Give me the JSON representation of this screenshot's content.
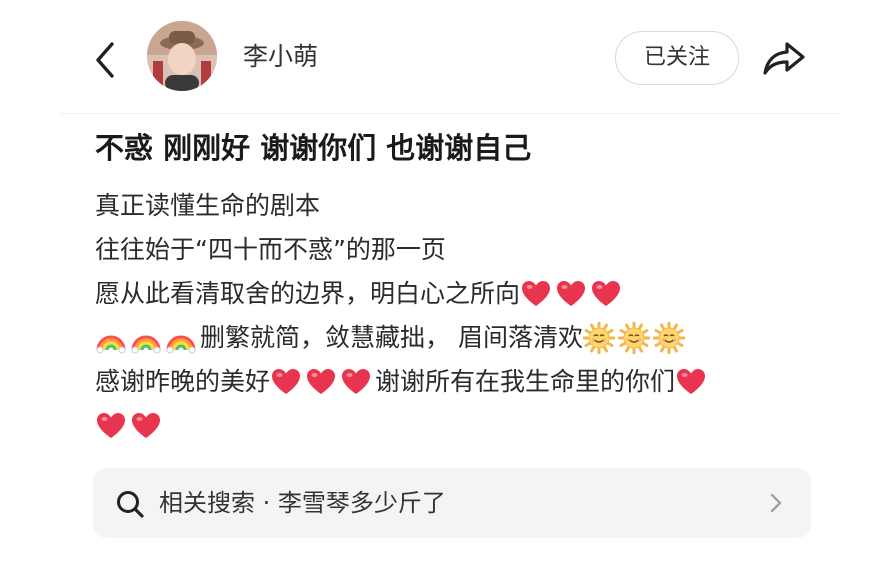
{
  "header": {
    "username": "李小萌",
    "follow_label": "已关注"
  },
  "post": {
    "title": "不惑 刚刚好 谢谢你们 也谢谢自己",
    "lines": {
      "l1": "真正读懂生命的剧本",
      "l2": "往往始于“四十而不惑”的那一页",
      "l3": "愿从此看清取舍的边界，明白心之所向",
      "l4": "删繁就简，敛慧藏拙， 眉间落清欢",
      "l5a": "感谢昨晚的美好",
      "l5b": "谢谢所有在我生命里的你们"
    }
  },
  "related_search": {
    "text": "相关搜索 · 李雪琴多少斤了"
  },
  "icons": {
    "back": "chevron-left-icon",
    "share": "share-arrow-icon",
    "search": "search-icon",
    "chevron": "chevron-right-icon",
    "heart": "red-heart-emoji",
    "rainbow": "rainbow-emoji",
    "sun": "smiling-sun-emoji"
  },
  "colors": {
    "heart": "#e8344e",
    "sun": "#f4b64a",
    "related_bg": "#f3f4f6"
  }
}
